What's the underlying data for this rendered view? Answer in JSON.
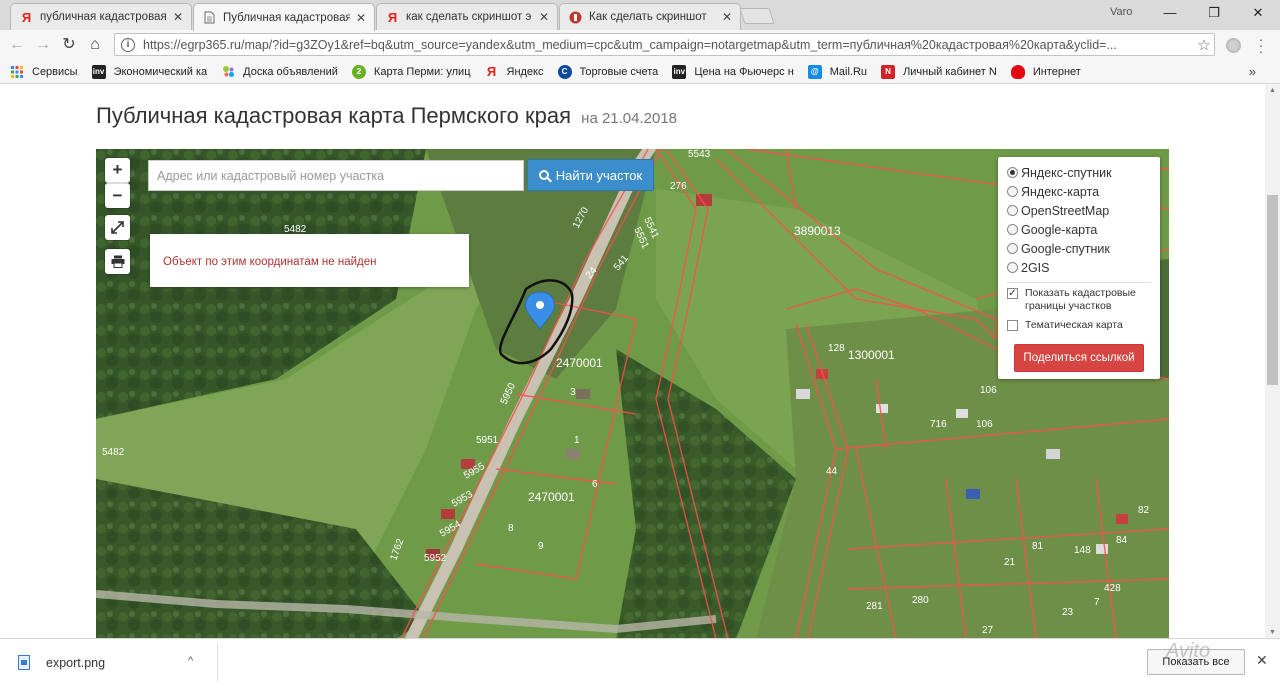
{
  "tabs": [
    {
      "title": "публичная кадастровая",
      "favicon": "yandex-icon",
      "favicon_text": "Я",
      "favicon_color": "#e8211e"
    },
    {
      "title": "Публичная кадастровая",
      "favicon": "page-icon",
      "favicon_text": "",
      "favicon_color": "#777777"
    },
    {
      "title": "как сделать скриншот э",
      "favicon": "yandex-icon",
      "favicon_text": "Я",
      "favicon_color": "#e8211e"
    },
    {
      "title": "Как сделать скриншот",
      "favicon": "site-icon",
      "favicon_text": "",
      "favicon_color": "#c0392b"
    }
  ],
  "window": {
    "profile": "Varo",
    "minimize": "—",
    "restore": "❐",
    "close": "✕"
  },
  "toolbar": {
    "back": "←",
    "forward": "→",
    "reload": "↻",
    "home": "⌂",
    "url": "https://egrp365.ru/map/?id=g3ZOy1&ref=bq&utm_source=yandex&utm_medium=cpc&utm_campaign=notargetmap&utm_term=публичная%20кадастровая%20карта&yclid=...",
    "star": "☆"
  },
  "bookmarks": [
    {
      "label": "Сервисы",
      "icon": "apps-icon",
      "color": "#4285f4",
      "glyph": ""
    },
    {
      "label": "Экономический ка",
      "icon": "inv-icon",
      "color": "#222222",
      "glyph": "inv"
    },
    {
      "label": "Доска объявлений",
      "icon": "avito-icon",
      "color": "#97cf26",
      "glyph": ""
    },
    {
      "label": "Карта Перми: улиц",
      "icon": "map-icon",
      "color": "#6ab023",
      "glyph": "2"
    },
    {
      "label": "Яндекс",
      "icon": "yandex-icon",
      "color": "#e8211e",
      "glyph": "Я"
    },
    {
      "label": "Торговые счета",
      "icon": "broker-icon",
      "color": "#0a4a9c",
      "glyph": "C"
    },
    {
      "label": "Цена на Фьючерс н",
      "icon": "inv-icon",
      "color": "#222222",
      "glyph": "inv"
    },
    {
      "label": "Mail.Ru",
      "icon": "mailru-icon",
      "color": "#168de2",
      "glyph": "@"
    },
    {
      "label": "Личный кабинет N",
      "icon": "n-icon",
      "color": "#d2232a",
      "glyph": "N"
    },
    {
      "label": "Интернет",
      "icon": "mts-icon",
      "color": "#e30611",
      "glyph": ""
    }
  ],
  "bookmarks_more": "»",
  "page": {
    "title": "Публичная кадастровая карта Пермского края",
    "date": "на 21.04.2018"
  },
  "map": {
    "zoom_in": "+",
    "zoom_out": "−",
    "fullscreen": "⤢",
    "print": "🖶",
    "search_placeholder": "Адрес или кадастровый номер участка",
    "search_button": "Найти участок",
    "not_found": "Объект по этим координатам не найден",
    "layers": [
      {
        "label": "Яндекс-спутник",
        "selected": true
      },
      {
        "label": "Яндекс-карта",
        "selected": false
      },
      {
        "label": "OpenStreetMap",
        "selected": false
      },
      {
        "label": "Google-карта",
        "selected": false
      },
      {
        "label": "Google-спутник",
        "selected": false
      },
      {
        "label": "2GIS",
        "selected": false
      }
    ],
    "show_borders": {
      "label": "Показать кадастровые границы участков",
      "checked": true
    },
    "thematic": {
      "label": "Тематическая карта",
      "checked": false
    },
    "share_button": "Поделиться ссылкой",
    "parcel_labels": [
      "5543",
      "276",
      "5541",
      "5551",
      "5482",
      "3890013",
      "1270",
      "24",
      "541",
      "2470001",
      "1300001",
      "128",
      "5950",
      "3",
      "5951",
      "1",
      "5955",
      "5953",
      "6",
      "2470001",
      "5954",
      "8",
      "9",
      "5952",
      "5482",
      "1762",
      "106",
      "716",
      "106",
      "44",
      "82",
      "148",
      "84",
      "428",
      "281",
      "280",
      "7",
      "21",
      "81",
      "23",
      "27"
    ]
  },
  "downloads": {
    "file": "export.png",
    "chevron": "^",
    "show_all": "Показать все",
    "close": "✕"
  },
  "watermark": "Avito"
}
